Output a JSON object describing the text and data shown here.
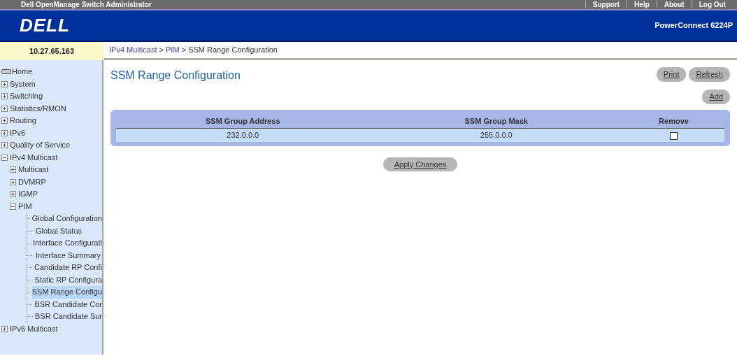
{
  "top_bar": {
    "title": "Dell OpenManage Switch Administrator",
    "links": [
      "Support",
      "Help",
      "About",
      "Log Out"
    ]
  },
  "header": {
    "logo": "DELL",
    "model": "PowerConnect 6224P"
  },
  "ip_address": "10.27.65.163",
  "breadcrumb": {
    "links": [
      "IPv4 Multicast",
      "PIM"
    ],
    "separator": ">",
    "current": "SSM Range Configuration"
  },
  "sidebar": {
    "items": [
      {
        "label": "Home",
        "kind": "home",
        "selected": false
      },
      {
        "label": "System",
        "kind": "folder",
        "expanded": false,
        "selected": false
      },
      {
        "label": "Switching",
        "kind": "folder",
        "expanded": false,
        "selected": false
      },
      {
        "label": "Statistics/RMON",
        "kind": "folder",
        "expanded": false,
        "selected": false
      },
      {
        "label": "Routing",
        "kind": "folder",
        "expanded": false,
        "selected": false
      },
      {
        "label": "IPv6",
        "kind": "folder",
        "expanded": false,
        "selected": false
      },
      {
        "label": "Quality of Service",
        "kind": "folder",
        "expanded": false,
        "selected": false
      },
      {
        "label": "IPv4 Multicast",
        "kind": "folder",
        "expanded": true,
        "selected": false,
        "children": [
          {
            "label": "Multicast",
            "kind": "folder",
            "expanded": false,
            "selected": false
          },
          {
            "label": "DVMRP",
            "kind": "folder",
            "expanded": false,
            "selected": false
          },
          {
            "label": "IGMP",
            "kind": "folder",
            "expanded": false,
            "selected": false
          },
          {
            "label": "PIM",
            "kind": "folder",
            "expanded": true,
            "selected": false,
            "children": [
              {
                "label": "Global Configuration",
                "kind": "page",
                "selected": false
              },
              {
                "label": "Global Status",
                "kind": "page",
                "selected": false
              },
              {
                "label": "Interface Configurati",
                "kind": "page",
                "selected": false
              },
              {
                "label": "Interface Summary",
                "kind": "page",
                "selected": false
              },
              {
                "label": "Candidate RP Confi",
                "kind": "page",
                "selected": false
              },
              {
                "label": "Static RP Configura",
                "kind": "page",
                "selected": false
              },
              {
                "label": "SSM Range Configu",
                "kind": "page",
                "selected": true
              },
              {
                "label": "BSR Candidate Cor",
                "kind": "page",
                "selected": false
              },
              {
                "label": "BSR Candidate Sur",
                "kind": "page",
                "selected": false
              }
            ]
          }
        ]
      },
      {
        "label": "IPv6 Multicast",
        "kind": "folder",
        "expanded": false,
        "selected": false
      }
    ]
  },
  "page": {
    "title": "SSM Range Configuration",
    "top_buttons": [
      "Print",
      "Refresh"
    ],
    "add_button": "Add",
    "table": {
      "columns": [
        "SSM Group Address",
        "SSM Group Mask",
        "Remove"
      ],
      "rows": [
        {
          "address": "232.0.0.0",
          "mask": "255.0.0.0",
          "remove": false
        }
      ]
    },
    "apply_button": "Apply Changes"
  }
}
